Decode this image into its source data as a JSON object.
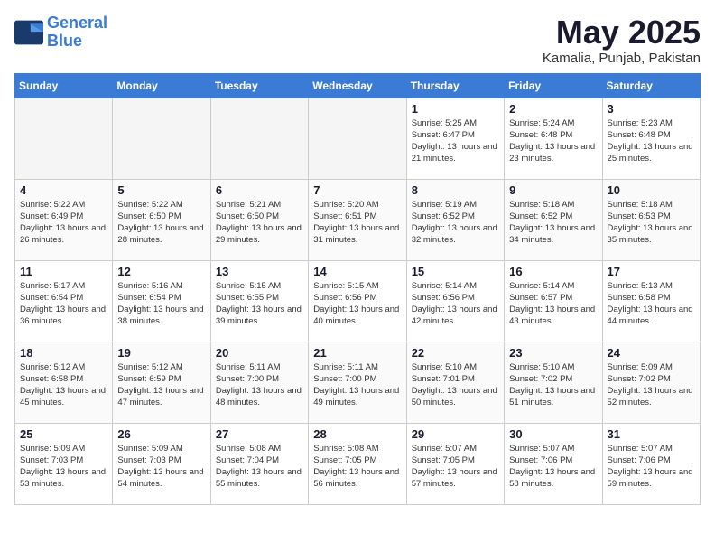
{
  "header": {
    "logo_line1": "General",
    "logo_line2": "Blue",
    "month": "May 2025",
    "location": "Kamalia, Punjab, Pakistan"
  },
  "days_of_week": [
    "Sunday",
    "Monday",
    "Tuesday",
    "Wednesday",
    "Thursday",
    "Friday",
    "Saturday"
  ],
  "weeks": [
    [
      {
        "day": "",
        "empty": true
      },
      {
        "day": "",
        "empty": true
      },
      {
        "day": "",
        "empty": true
      },
      {
        "day": "",
        "empty": true
      },
      {
        "day": "1",
        "info": "Sunrise: 5:25 AM\nSunset: 6:47 PM\nDaylight: 13 hours\nand 21 minutes."
      },
      {
        "day": "2",
        "info": "Sunrise: 5:24 AM\nSunset: 6:48 PM\nDaylight: 13 hours\nand 23 minutes."
      },
      {
        "day": "3",
        "info": "Sunrise: 5:23 AM\nSunset: 6:48 PM\nDaylight: 13 hours\nand 25 minutes."
      }
    ],
    [
      {
        "day": "4",
        "info": "Sunrise: 5:22 AM\nSunset: 6:49 PM\nDaylight: 13 hours\nand 26 minutes."
      },
      {
        "day": "5",
        "info": "Sunrise: 5:22 AM\nSunset: 6:50 PM\nDaylight: 13 hours\nand 28 minutes."
      },
      {
        "day": "6",
        "info": "Sunrise: 5:21 AM\nSunset: 6:50 PM\nDaylight: 13 hours\nand 29 minutes."
      },
      {
        "day": "7",
        "info": "Sunrise: 5:20 AM\nSunset: 6:51 PM\nDaylight: 13 hours\nand 31 minutes."
      },
      {
        "day": "8",
        "info": "Sunrise: 5:19 AM\nSunset: 6:52 PM\nDaylight: 13 hours\nand 32 minutes."
      },
      {
        "day": "9",
        "info": "Sunrise: 5:18 AM\nSunset: 6:52 PM\nDaylight: 13 hours\nand 34 minutes."
      },
      {
        "day": "10",
        "info": "Sunrise: 5:18 AM\nSunset: 6:53 PM\nDaylight: 13 hours\nand 35 minutes."
      }
    ],
    [
      {
        "day": "11",
        "info": "Sunrise: 5:17 AM\nSunset: 6:54 PM\nDaylight: 13 hours\nand 36 minutes."
      },
      {
        "day": "12",
        "info": "Sunrise: 5:16 AM\nSunset: 6:54 PM\nDaylight: 13 hours\nand 38 minutes."
      },
      {
        "day": "13",
        "info": "Sunrise: 5:15 AM\nSunset: 6:55 PM\nDaylight: 13 hours\nand 39 minutes."
      },
      {
        "day": "14",
        "info": "Sunrise: 5:15 AM\nSunset: 6:56 PM\nDaylight: 13 hours\nand 40 minutes."
      },
      {
        "day": "15",
        "info": "Sunrise: 5:14 AM\nSunset: 6:56 PM\nDaylight: 13 hours\nand 42 minutes."
      },
      {
        "day": "16",
        "info": "Sunrise: 5:14 AM\nSunset: 6:57 PM\nDaylight: 13 hours\nand 43 minutes."
      },
      {
        "day": "17",
        "info": "Sunrise: 5:13 AM\nSunset: 6:58 PM\nDaylight: 13 hours\nand 44 minutes."
      }
    ],
    [
      {
        "day": "18",
        "info": "Sunrise: 5:12 AM\nSunset: 6:58 PM\nDaylight: 13 hours\nand 45 minutes."
      },
      {
        "day": "19",
        "info": "Sunrise: 5:12 AM\nSunset: 6:59 PM\nDaylight: 13 hours\nand 47 minutes."
      },
      {
        "day": "20",
        "info": "Sunrise: 5:11 AM\nSunset: 7:00 PM\nDaylight: 13 hours\nand 48 minutes."
      },
      {
        "day": "21",
        "info": "Sunrise: 5:11 AM\nSunset: 7:00 PM\nDaylight: 13 hours\nand 49 minutes."
      },
      {
        "day": "22",
        "info": "Sunrise: 5:10 AM\nSunset: 7:01 PM\nDaylight: 13 hours\nand 50 minutes."
      },
      {
        "day": "23",
        "info": "Sunrise: 5:10 AM\nSunset: 7:02 PM\nDaylight: 13 hours\nand 51 minutes."
      },
      {
        "day": "24",
        "info": "Sunrise: 5:09 AM\nSunset: 7:02 PM\nDaylight: 13 hours\nand 52 minutes."
      }
    ],
    [
      {
        "day": "25",
        "info": "Sunrise: 5:09 AM\nSunset: 7:03 PM\nDaylight: 13 hours\nand 53 minutes."
      },
      {
        "day": "26",
        "info": "Sunrise: 5:09 AM\nSunset: 7:03 PM\nDaylight: 13 hours\nand 54 minutes."
      },
      {
        "day": "27",
        "info": "Sunrise: 5:08 AM\nSunset: 7:04 PM\nDaylight: 13 hours\nand 55 minutes."
      },
      {
        "day": "28",
        "info": "Sunrise: 5:08 AM\nSunset: 7:05 PM\nDaylight: 13 hours\nand 56 minutes."
      },
      {
        "day": "29",
        "info": "Sunrise: 5:07 AM\nSunset: 7:05 PM\nDaylight: 13 hours\nand 57 minutes."
      },
      {
        "day": "30",
        "info": "Sunrise: 5:07 AM\nSunset: 7:06 PM\nDaylight: 13 hours\nand 58 minutes."
      },
      {
        "day": "31",
        "info": "Sunrise: 5:07 AM\nSunset: 7:06 PM\nDaylight: 13 hours\nand 59 minutes."
      }
    ]
  ]
}
